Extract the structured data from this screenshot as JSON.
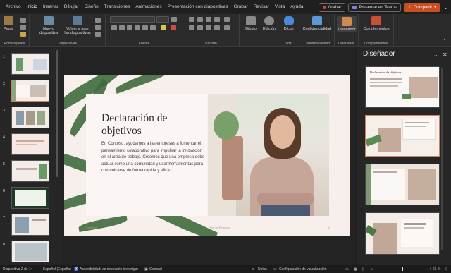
{
  "menu": {
    "tabs": [
      "Archivo",
      "Inicio",
      "Insertar",
      "Dibujar",
      "Diseño",
      "Transiciones",
      "Animaciones",
      "Presentación con diapositivas",
      "Grabar",
      "Revisar",
      "Vista",
      "Ayuda"
    ],
    "active": "Inicio",
    "record_label": "Grabar",
    "teams_label": "Presentar en Teams",
    "share_label": "Compartir"
  },
  "ribbon": {
    "paste_label": "Pegar",
    "new_slide_label": "Nuevo diapositiva",
    "reuse_label": "Volver a usar las diapositivas",
    "drawing_label": "Dibujo",
    "editing_label": "Edición",
    "dictate_label": "Dictar",
    "sensitivity_label": "Confidencialidad",
    "designer_label": "Diseñador",
    "addins_label": "Complementos",
    "groups": {
      "clipboard": "Portapapeles",
      "slides": "Diapositivas",
      "font": "Fuente",
      "paragraph": "Párrafo",
      "voice": "Voz",
      "sensitivity": "Confidencialidad",
      "designer": "Diseñador",
      "addins": "Complementos"
    }
  },
  "thumbnails": [
    "1",
    "2",
    "3",
    "4",
    "5",
    "6",
    "7",
    "8"
  ],
  "selected_slide": 2,
  "slide": {
    "title": "Declaración de objetivos",
    "body": "En Contoso, ayudamos a las empresas a fomentar el pensamiento colaborativo para impulsar la innovación en el área de trabajo. Creemos que una empresa debe actuar como una comunidad y usar herramientas para comunicarse de forma rápida y eficaz.",
    "footer_left": "Contoso",
    "footer_mid": "Plan de Empresa",
    "page_number": "2"
  },
  "designer": {
    "title": "Diseñador",
    "design_title": "Declaración de objetivos"
  },
  "status": {
    "slide_count": "Diapositiva 2 de 14",
    "language": "Español (España)",
    "accessibility": "Accesibilidad: es necesario investigar",
    "general": "General",
    "notes": "Notas",
    "display": "Configuración de visualización",
    "zoom": "66 %"
  },
  "colors": {
    "accent": "#e8734a",
    "share": "#c94f23",
    "selected_border": "#d08060"
  }
}
